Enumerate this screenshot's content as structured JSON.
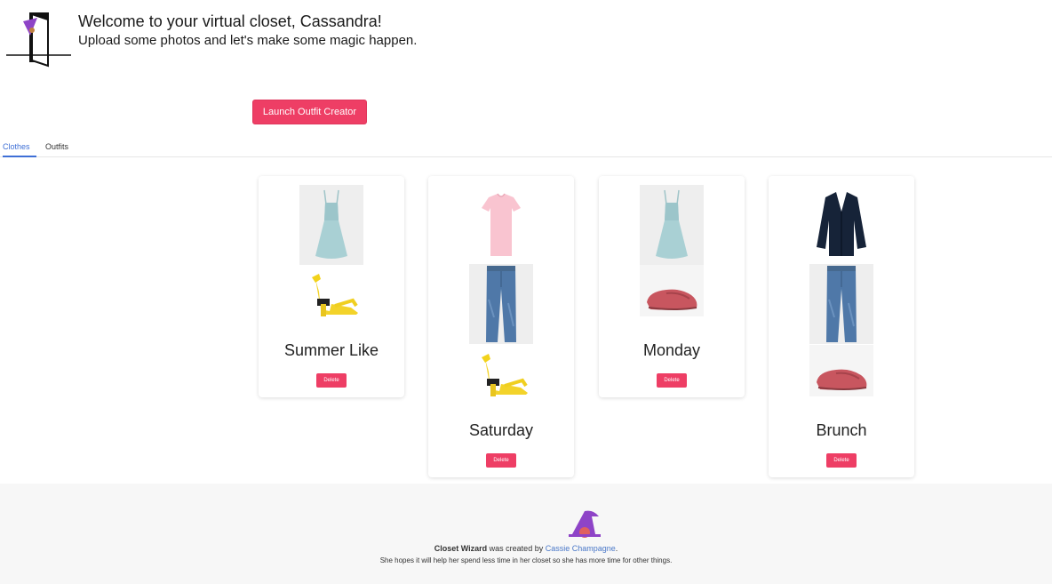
{
  "header": {
    "title": "Welcome to your virtual closet, Cassandra!",
    "subtitle": "Upload some photos and let's make some magic happen."
  },
  "actions": {
    "launch_label": "Launch Outfit Creator"
  },
  "tabs": [
    {
      "label": "Clothes",
      "active": true
    },
    {
      "label": "Outfits",
      "active": false
    }
  ],
  "outfits": [
    {
      "name": "Summer Like",
      "items": [
        "dress",
        "sandals"
      ],
      "delete_label": "Delete"
    },
    {
      "name": "Saturday",
      "items": [
        "t-shirt",
        "jeans",
        "sandals"
      ],
      "delete_label": "Delete"
    },
    {
      "name": "Monday",
      "items": [
        "dress",
        "flats"
      ],
      "delete_label": "Delete"
    },
    {
      "name": "Brunch",
      "items": [
        "cardigan",
        "jeans",
        "flats"
      ],
      "delete_label": "Delete"
    }
  ],
  "footer": {
    "app_name": "Closet Wizard",
    "created_text": " was created by ",
    "author": "Cassie Champagne",
    "period": ".",
    "tagline": "She hopes it will help her spend less time in her closet so she has more time for other things."
  },
  "colors": {
    "accent": "#ee3e65",
    "link": "#3e6fd6",
    "wizard_purple": "#8e44c7"
  }
}
